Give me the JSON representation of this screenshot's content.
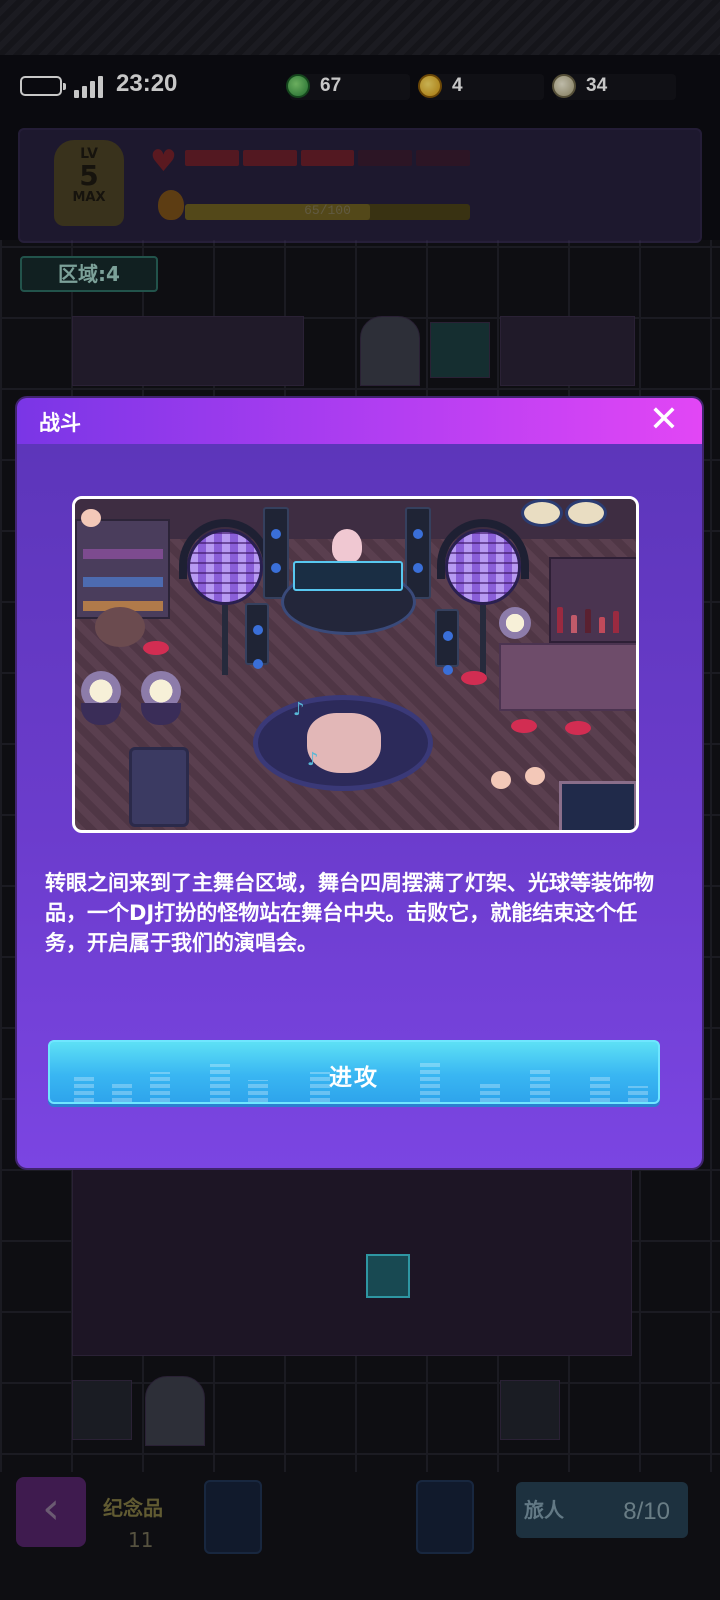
{
  "status_bar": {
    "time": "23:20"
  },
  "currencies": [
    {
      "icon": "green-gem-icon",
      "value": "67"
    },
    {
      "icon": "gold-coin-icon",
      "value": "4"
    },
    {
      "icon": "silver-coin-icon",
      "value": "34"
    }
  ],
  "hud": {
    "level_prefix": "LV",
    "level": "5",
    "level_max": "MAX",
    "hp_segments_filled": 3,
    "hp_segments_total": 5,
    "xp_text": "65/100",
    "xp_fraction": 0.65
  },
  "zone": {
    "label": "区域:4"
  },
  "dialog": {
    "title": "战斗",
    "description": "转眼之间来到了主舞台区域，舞台四周摆满了灯架、光球等装饰物品，一个DJ打扮的怪物站在舞台中央。击败它，就能结束这个任务，开启属于我们的演唱会。",
    "attack_label": "进攻"
  },
  "bottom_bar": {
    "souvenir_label": "纪念品",
    "souvenir_count": "11",
    "traveler_label": "旅人",
    "traveler_count": "8/10"
  },
  "colors": {
    "modal_header_start": "#7a36e6",
    "modal_header_end": "#e246f5",
    "modal_body": "#6b3ccc",
    "attack_button": "#39b6f2"
  }
}
